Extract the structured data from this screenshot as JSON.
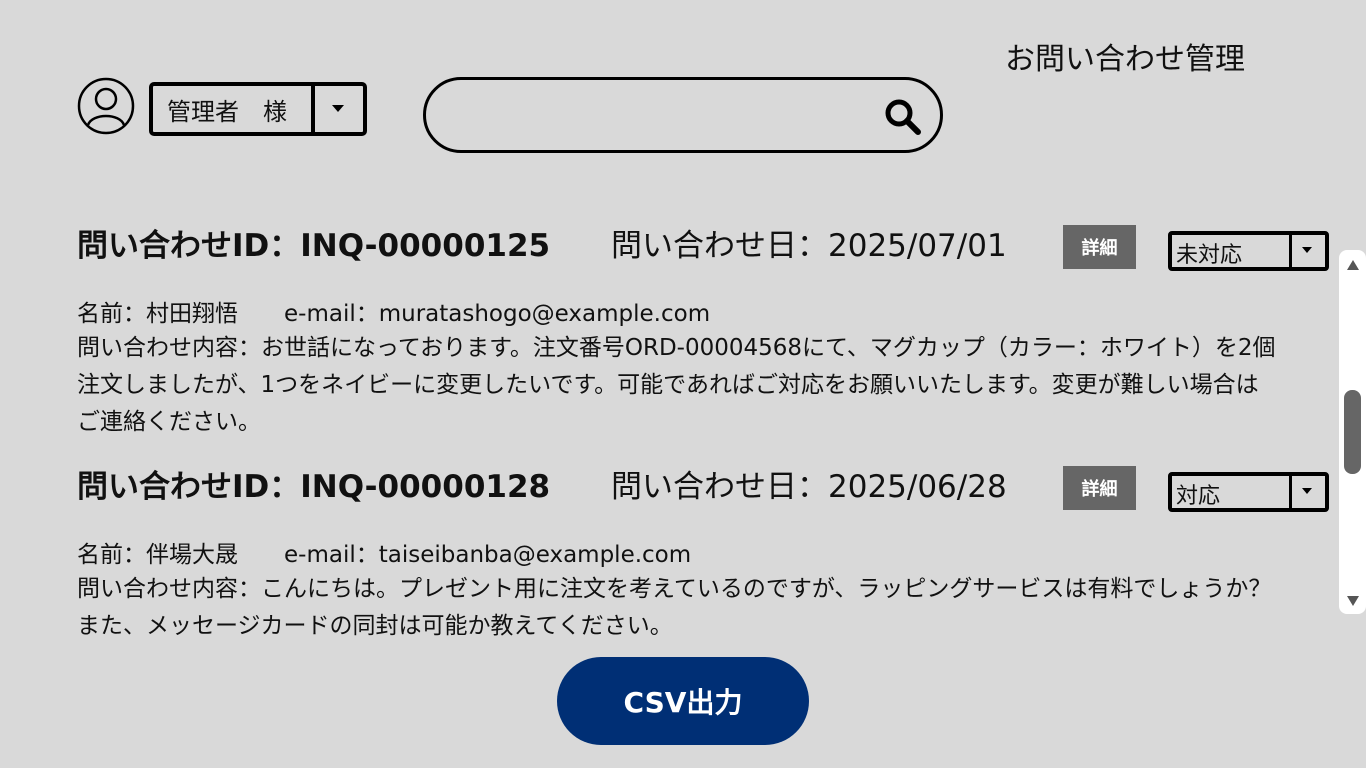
{
  "header": {
    "title": "お問い合わせ管理",
    "user_name": "管理者　様",
    "search_placeholder": ""
  },
  "inquiries": [
    {
      "id_label": "問い合わせID：INQ-00000125",
      "date_label": "問い合わせ日：2025/07/01",
      "detail_label": "詳細",
      "status": "未対応",
      "meta": "名前：村田翔悟　　e-mail：muratashogo@example.com",
      "body": "問い合わせ内容：お世話になっております。注文番号ORD-00004568にて、マグカップ（カラー：ホワイト）を2個注文しましたが、1つをネイビーに変更したいです。可能であればご対応をお願いいたします。変更が難しい場合はご連絡ください。"
    },
    {
      "id_label": "問い合わせID：INQ-00000128",
      "date_label": "問い合わせ日：2025/06/28",
      "detail_label": "詳細",
      "status": "対応",
      "meta": "名前：伴場大晟　　e-mail：taiseibanba@example.com",
      "body": "問い合わせ内容：こんにちは。プレゼント用に注文を考えているのですが、ラッピングサービスは有料でしょうか？また、メッセージカードの同封は可能か教えてください。"
    }
  ],
  "footer": {
    "csv_label": "CSV出力"
  },
  "colors": {
    "background": "#d9d9d9",
    "primary_button": "#002f75",
    "detail_button": "#666666"
  },
  "icons": {
    "avatar": "user-circle-icon",
    "search": "search-icon",
    "dropdown": "caret-down-icon"
  }
}
